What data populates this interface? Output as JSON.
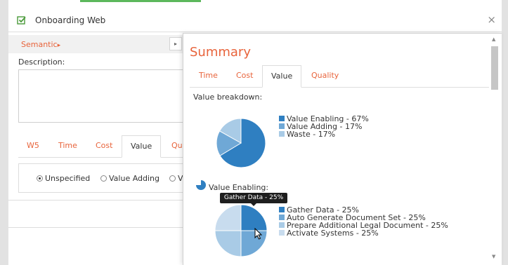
{
  "window": {
    "title": "Onboarding Web",
    "close_glyph": "×"
  },
  "left": {
    "semantic_label": "Semantic",
    "semantic_arrow": "▸",
    "collapse_arrow": "▸",
    "description_label": "Description:",
    "tabs": [
      {
        "label": "W5"
      },
      {
        "label": "Time"
      },
      {
        "label": "Cost"
      },
      {
        "label": "Value"
      },
      {
        "label": "Qu"
      }
    ],
    "radios": [
      {
        "label": "Unspecified",
        "selected": true
      },
      {
        "label": "Value Adding",
        "selected": false
      },
      {
        "label": "V",
        "selected": false
      }
    ]
  },
  "summary": {
    "title": "Summary",
    "tabs": [
      {
        "label": "Time"
      },
      {
        "label": "Cost"
      },
      {
        "label": "Value"
      },
      {
        "label": "Quality"
      }
    ],
    "value_breakdown_label": "Value breakdown:",
    "value_enabling_label": "Value Enabling:",
    "tooltip": "Gather Data - 25%"
  },
  "chart_data": [
    {
      "type": "pie",
      "title": "Value breakdown:",
      "labels": [
        "Value Enabling - 67%",
        "Value Adding - 17%",
        "Waste - 17%"
      ],
      "values": [
        67,
        17,
        17
      ],
      "colors": [
        "#2f7fc1",
        "#6fa8d6",
        "#a9cbe6"
      ],
      "legend": "right"
    },
    {
      "type": "pie",
      "title": "Value Enabling:",
      "labels": [
        "Gather Data - 25%",
        "Auto Generate Document Set - 25%",
        "Prepare Additional Legal Document - 25%",
        "Activate Systems - 25%"
      ],
      "values": [
        25,
        25,
        25,
        25
      ],
      "colors": [
        "#2f7fc1",
        "#6fa8d6",
        "#a9cbe6",
        "#c8dcee"
      ],
      "legend": "right"
    }
  ],
  "colors": {
    "accent": "#e8643c",
    "check_green": "#4a9a3a"
  }
}
